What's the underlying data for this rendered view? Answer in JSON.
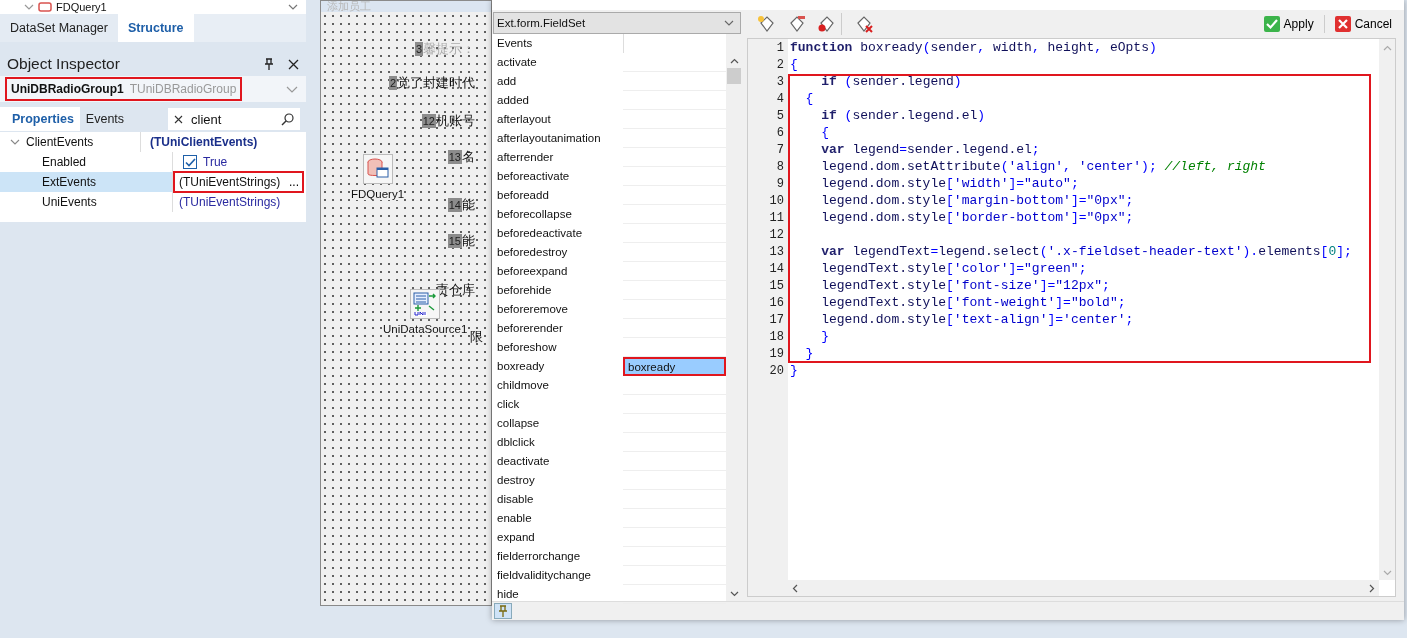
{
  "structure_tree": {
    "item": "FDQuery1"
  },
  "manager_tabs": [
    {
      "label": "DataSet Manager",
      "selected": false
    },
    {
      "label": "Structure",
      "selected": true
    }
  ],
  "object_inspector": {
    "title": "Object Inspector",
    "component": {
      "name": "UniDBRadioGroup1",
      "type": "TUniDBRadioGroup",
      "highlighted": true
    },
    "tabs": [
      {
        "label": "Properties",
        "selected": true
      },
      {
        "label": "Events",
        "selected": false
      }
    ],
    "search": {
      "value": "client"
    },
    "properties": [
      {
        "name": "ClientEvents",
        "kind": "group",
        "value": "(TUniClientEvents)",
        "expanded": true,
        "selected": false,
        "children": [
          {
            "name": "Enabled",
            "kind": "bool",
            "value": "True",
            "checked": true,
            "selected": false
          },
          {
            "name": "ExtEvents",
            "kind": "object",
            "value": "(TUniEventStrings)",
            "button": "...",
            "selected": true,
            "highlighted": true
          },
          {
            "name": "UniEvents",
            "kind": "object",
            "value": "(TUniEventStrings)",
            "selected": false
          }
        ]
      }
    ]
  },
  "designer": {
    "title": "添加员工",
    "labels": [
      {
        "badge": "3",
        "text": "馨提示：",
        "dim": true
      },
      {
        "badge": "2",
        "text": "觉了封建时代",
        "dim": false
      },
      {
        "badge": "12",
        "text": "机账号",
        "dim": false
      },
      {
        "badge": "13",
        "text": "名",
        "dim": false
      },
      {
        "badge": "14",
        "text": "能",
        "dim": false
      },
      {
        "badge": "15",
        "text": "能",
        "dim": false
      },
      {
        "text": "责仓库",
        "dim": false
      },
      {
        "text": "限",
        "dim": false
      }
    ],
    "components": [
      {
        "name": "FDQuery1",
        "kind": "query"
      },
      {
        "name": "UniDataSource1",
        "kind": "datasource"
      }
    ]
  },
  "event_editor": {
    "class_select": "Ext.form.FieldSet",
    "list_header": "Events",
    "events": [
      {
        "name": "activate",
        "selected": false
      },
      {
        "name": "add",
        "selected": false
      },
      {
        "name": "added",
        "selected": false
      },
      {
        "name": "afterlayout",
        "selected": false
      },
      {
        "name": "afterlayoutanimation",
        "selected": false
      },
      {
        "name": "afterrender",
        "selected": false
      },
      {
        "name": "beforeactivate",
        "selected": false
      },
      {
        "name": "beforeadd",
        "selected": false
      },
      {
        "name": "beforecollapse",
        "selected": false
      },
      {
        "name": "beforedeactivate",
        "selected": false
      },
      {
        "name": "beforedestroy",
        "selected": false
      },
      {
        "name": "beforeexpand",
        "selected": false
      },
      {
        "name": "beforehide",
        "selected": false
      },
      {
        "name": "beforeremove",
        "selected": false
      },
      {
        "name": "beforerender",
        "selected": false
      },
      {
        "name": "beforeshow",
        "selected": false
      },
      {
        "name": "boxready",
        "handler": "boxready",
        "selected": true,
        "highlighted": true
      },
      {
        "name": "childmove",
        "selected": false
      },
      {
        "name": "click",
        "selected": false
      },
      {
        "name": "collapse",
        "selected": false
      },
      {
        "name": "dblclick",
        "selected": false
      },
      {
        "name": "deactivate",
        "selected": false
      },
      {
        "name": "destroy",
        "selected": false
      },
      {
        "name": "disable",
        "selected": false
      },
      {
        "name": "enable",
        "selected": false
      },
      {
        "name": "expand",
        "selected": false
      },
      {
        "name": "fielderrorchange",
        "selected": false
      },
      {
        "name": "fieldvaliditychange",
        "selected": false
      },
      {
        "name": "hide",
        "selected": false
      }
    ],
    "toolbar": [
      {
        "kind": "new"
      },
      {
        "kind": "edit"
      },
      {
        "kind": "record"
      },
      {
        "kind": "delete"
      }
    ],
    "apply": "Apply",
    "cancel": "Cancel",
    "code_blocks": [
      {
        "highlighted": false,
        "lines": [
          {
            "num": "1",
            "segments": [
              {
                "kind": "kw",
                "text": "function"
              },
              {
                "kind": "id",
                "text": " boxready"
              },
              {
                "kind": "sym",
                "text": "("
              },
              {
                "kind": "id",
                "text": "sender"
              },
              {
                "kind": "sym",
                "text": ", "
              },
              {
                "kind": "id",
                "text": "width"
              },
              {
                "kind": "sym",
                "text": ", "
              },
              {
                "kind": "id",
                "text": "height"
              },
              {
                "kind": "sym",
                "text": ", "
              },
              {
                "kind": "id",
                "text": "eOpts"
              },
              {
                "kind": "sym",
                "text": ")"
              }
            ]
          },
          {
            "num": "2",
            "segments": [
              {
                "kind": "sym",
                "text": "{"
              }
            ]
          }
        ]
      },
      {
        "highlighted": true,
        "lines": [
          {
            "num": "3",
            "segments": [
              {
                "kind": "kw",
                "text": "    if"
              },
              {
                "kind": "sym",
                "text": " ("
              },
              {
                "kind": "id",
                "text": "sender.legend"
              },
              {
                "kind": "sym",
                "text": ")"
              }
            ]
          },
          {
            "num": "4",
            "segments": [
              {
                "kind": "sym",
                "text": "  {"
              }
            ]
          },
          {
            "num": "5",
            "segments": [
              {
                "kind": "kw",
                "text": "    if"
              },
              {
                "kind": "sym",
                "text": " ("
              },
              {
                "kind": "id",
                "text": "sender.legend.el"
              },
              {
                "kind": "sym",
                "text": ")"
              }
            ]
          },
          {
            "num": "6",
            "segments": [
              {
                "kind": "sym",
                "text": "    {"
              }
            ]
          },
          {
            "num": "7",
            "segments": [
              {
                "kind": "kw",
                "text": "    var"
              },
              {
                "kind": "id",
                "text": " legend"
              },
              {
                "kind": "sym",
                "text": "="
              },
              {
                "kind": "id",
                "text": "sender.legend.el"
              },
              {
                "kind": "sym",
                "text": ";"
              }
            ]
          },
          {
            "num": "8",
            "segments": [
              {
                "kind": "id",
                "text": "    legend.dom.setAttribute"
              },
              {
                "kind": "sym",
                "text": "("
              },
              {
                "kind": "str",
                "text": "'align'"
              },
              {
                "kind": "sym",
                "text": ", "
              },
              {
                "kind": "str",
                "text": "'center'"
              },
              {
                "kind": "sym",
                "text": ");"
              },
              {
                "kind": "com",
                "text": " //left, right"
              }
            ]
          },
          {
            "num": "9",
            "segments": [
              {
                "kind": "id",
                "text": "    legend.dom.style"
              },
              {
                "kind": "sym",
                "text": "["
              },
              {
                "kind": "str",
                "text": "'width'"
              },
              {
                "kind": "sym",
                "text": "]="
              },
              {
                "kind": "str",
                "text": "\"auto\""
              },
              {
                "kind": "sym",
                "text": ";"
              }
            ]
          },
          {
            "num": "10",
            "segments": [
              {
                "kind": "id",
                "text": "    legend.dom.style"
              },
              {
                "kind": "sym",
                "text": "["
              },
              {
                "kind": "str",
                "text": "'margin-bottom'"
              },
              {
                "kind": "sym",
                "text": "]="
              },
              {
                "kind": "str",
                "text": "\"0px\""
              },
              {
                "kind": "sym",
                "text": ";"
              }
            ]
          },
          {
            "num": "11",
            "segments": [
              {
                "kind": "id",
                "text": "    legend.dom.style"
              },
              {
                "kind": "sym",
                "text": "["
              },
              {
                "kind": "str",
                "text": "'border-bottom'"
              },
              {
                "kind": "sym",
                "text": "]="
              },
              {
                "kind": "str",
                "text": "\"0px\""
              },
              {
                "kind": "sym",
                "text": ";"
              }
            ]
          },
          {
            "num": "12"
          },
          {
            "num": "13",
            "segments": [
              {
                "kind": "kw",
                "text": "    var"
              },
              {
                "kind": "id",
                "text": " legendText"
              },
              {
                "kind": "sym",
                "text": "="
              },
              {
                "kind": "id",
                "text": "legend.select"
              },
              {
                "kind": "sym",
                "text": "("
              },
              {
                "kind": "str",
                "text": "'.x-fieldset-header-text'"
              },
              {
                "kind": "sym",
                "text": ")."
              },
              {
                "kind": "id",
                "text": "elements"
              },
              {
                "kind": "sym",
                "text": "["
              },
              {
                "kind": "num",
                "text": "0"
              },
              {
                "kind": "sym",
                "text": "];"
              }
            ]
          },
          {
            "num": "14",
            "segments": [
              {
                "kind": "id",
                "text": "    legendText.style"
              },
              {
                "kind": "sym",
                "text": "["
              },
              {
                "kind": "str",
                "text": "'color'"
              },
              {
                "kind": "sym",
                "text": "]="
              },
              {
                "kind": "str",
                "text": "\"green\""
              },
              {
                "kind": "sym",
                "text": ";"
              }
            ]
          },
          {
            "num": "15",
            "segments": [
              {
                "kind": "id",
                "text": "    legendText.style"
              },
              {
                "kind": "sym",
                "text": "["
              },
              {
                "kind": "str",
                "text": "'font-size'"
              },
              {
                "kind": "sym",
                "text": "]="
              },
              {
                "kind": "str",
                "text": "\"12px\""
              },
              {
                "kind": "sym",
                "text": ";"
              }
            ]
          },
          {
            "num": "16",
            "segments": [
              {
                "kind": "id",
                "text": "    legendText.style"
              },
              {
                "kind": "sym",
                "text": "["
              },
              {
                "kind": "str",
                "text": "'font-weight'"
              },
              {
                "kind": "sym",
                "text": "]="
              },
              {
                "kind": "str",
                "text": "\"bold\""
              },
              {
                "kind": "sym",
                "text": ";"
              }
            ]
          },
          {
            "num": "17",
            "segments": [
              {
                "kind": "id",
                "text": "    legend.dom.style"
              },
              {
                "kind": "sym",
                "text": "["
              },
              {
                "kind": "str",
                "text": "'text-align'"
              },
              {
                "kind": "sym",
                "text": "]="
              },
              {
                "kind": "str",
                "text": "'center'"
              },
              {
                "kind": "sym",
                "text": ";"
              }
            ]
          },
          {
            "num": "18",
            "segments": [
              {
                "kind": "sym",
                "text": "    }"
              }
            ]
          },
          {
            "num": "19",
            "segments": [
              {
                "kind": "sym",
                "text": "  }"
              }
            ]
          }
        ]
      },
      {
        "highlighted": false,
        "lines": [
          {
            "num": "20",
            "segments": [
              {
                "kind": "sym",
                "text": "}"
              }
            ]
          }
        ]
      }
    ]
  }
}
